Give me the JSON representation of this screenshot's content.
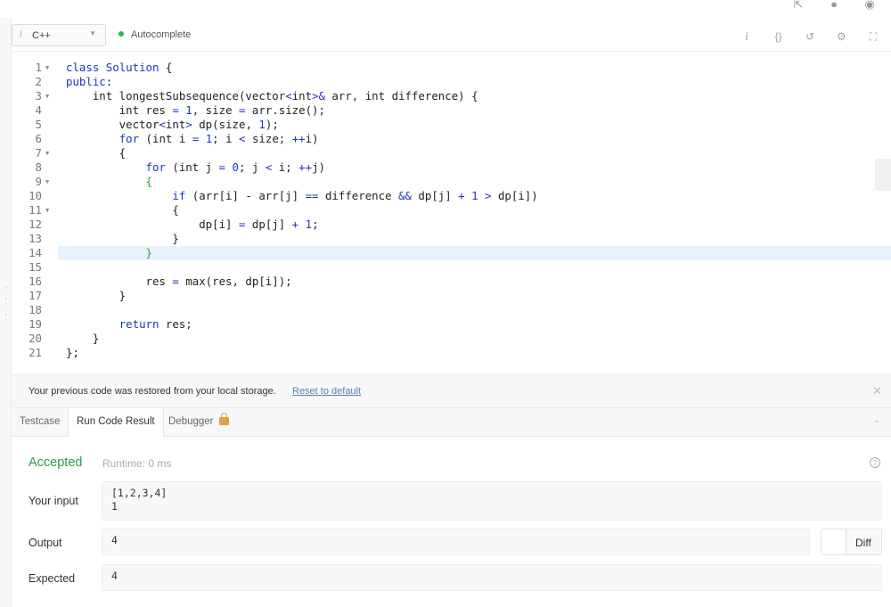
{
  "toolbar": {
    "language": "C++",
    "autocomplete_label": "Autocomplete"
  },
  "editor": {
    "lines": [
      {
        "n": "1",
        "fold": true
      },
      {
        "n": "2",
        "fold": false
      },
      {
        "n": "3",
        "fold": true
      },
      {
        "n": "4",
        "fold": false
      },
      {
        "n": "5",
        "fold": false
      },
      {
        "n": "6",
        "fold": false
      },
      {
        "n": "7",
        "fold": true
      },
      {
        "n": "8",
        "fold": false
      },
      {
        "n": "9",
        "fold": true
      },
      {
        "n": "10",
        "fold": false
      },
      {
        "n": "11",
        "fold": true
      },
      {
        "n": "12",
        "fold": false
      },
      {
        "n": "13",
        "fold": false
      },
      {
        "n": "14",
        "fold": false
      },
      {
        "n": "15",
        "fold": false
      },
      {
        "n": "16",
        "fold": false
      },
      {
        "n": "17",
        "fold": false
      },
      {
        "n": "18",
        "fold": false
      },
      {
        "n": "19",
        "fold": false
      },
      {
        "n": "20",
        "fold": false
      },
      {
        "n": "21",
        "fold": false
      }
    ],
    "active_line": 14,
    "code": [
      "class Solution {",
      "public:",
      "    int longestSubsequence(vector<int>& arr, int difference) {",
      "        int res = 1, size = arr.size();",
      "        vector<int> dp(size, 1);",
      "        for (int i = 1; i < size; ++i)",
      "        {",
      "            for (int j = 0; j < i; ++j)",
      "            {",
      "                if (arr[i] - arr[j] == difference && dp[j] + 1 > dp[i])",
      "                {",
      "                    dp[i] = dp[j] + 1;",
      "                }",
      "            }",
      "",
      "            res = max(res, dp[i]);",
      "        }",
      "",
      "        return res;",
      "    }",
      "};"
    ]
  },
  "restore": {
    "message": "Your previous code was restored from your local storage.",
    "reset_label": "Reset to default"
  },
  "tabs": {
    "testcase": "Testcase",
    "run_code_result": "Run Code Result",
    "debugger": "Debugger"
  },
  "result": {
    "status": "Accepted",
    "runtime": "Runtime: 0 ms",
    "input_label": "Your input",
    "input_value": "[1,2,3,4]\n1",
    "output_label": "Output",
    "output_value": "4",
    "expected_label": "Expected",
    "expected_value": "4",
    "diff_label": "Diff"
  },
  "colors": {
    "accepted": "#2d9b45",
    "keyword": "#1a38c4",
    "brace_highlight": "#2aa52a",
    "active_line": "#e8f2ff"
  }
}
